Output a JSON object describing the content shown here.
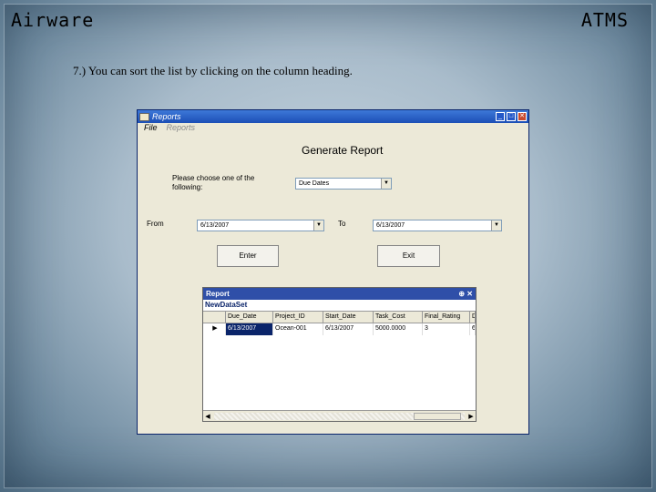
{
  "brand": {
    "left": "Airware",
    "right": "ATMS"
  },
  "instruction": "7.) You can sort the list by clicking on the column heading.",
  "window": {
    "title": "Reports",
    "menu": [
      "File",
      "Reports"
    ],
    "heading": "Generate Report",
    "choose_label": "Please choose one of the following:",
    "choice_value": "Due Dates",
    "from_label": "From",
    "from_value": "6/13/2007",
    "to_label": "To",
    "to_value": "6/13/2007",
    "enter_label": "Enter",
    "exit_label": "Exit"
  },
  "report": {
    "title": "Report",
    "pin": "⊕ ✕",
    "dataset": "NewDataSet",
    "columns": [
      "Due_Date",
      "Project_ID",
      "Start_Date",
      "Task_Cost",
      "Final_Rating",
      "D"
    ],
    "rows": [
      [
        "6/13/2007",
        "Ocean-001",
        "6/13/2007",
        "5000.0000",
        "3",
        "6"
      ]
    ]
  },
  "icons": [
    "app-icon",
    "minimize-icon",
    "maximize-icon",
    "close-icon",
    "dropdown-arrow-icon",
    "row-pointer-icon",
    "scroll-left-icon",
    "scroll-right-icon"
  ]
}
